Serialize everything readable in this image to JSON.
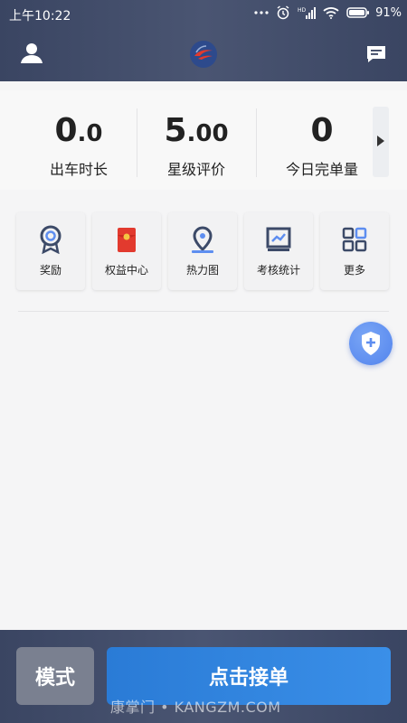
{
  "status_bar": {
    "time": "上午10:22",
    "battery": "91%"
  },
  "stats": [
    {
      "value_main": "0",
      "value_small": ".0",
      "label": "出车时长"
    },
    {
      "value_main": "5",
      "value_small": ".00",
      "label": "星级评价"
    },
    {
      "value_main": "0",
      "value_small": "",
      "label": "今日完单量"
    }
  ],
  "tiles": [
    {
      "label": "奖励",
      "icon": "medal-icon"
    },
    {
      "label": "权益中心",
      "icon": "red-envelope-icon"
    },
    {
      "label": "热力图",
      "icon": "location-pin-icon"
    },
    {
      "label": "考核统计",
      "icon": "chart-icon"
    },
    {
      "label": "更多",
      "icon": "grid-icon"
    }
  ],
  "bottom": {
    "mode_label": "模式",
    "accept_label": "点击接单"
  },
  "watermark": "康掌门 • KANGZM.COM",
  "colors": {
    "header_bg": "#3a4562",
    "accent_blue": "#2a7bd6",
    "fab_blue": "#5e8ef0",
    "icon_navy": "#3c4a68",
    "envelope_red": "#e23a2e"
  }
}
